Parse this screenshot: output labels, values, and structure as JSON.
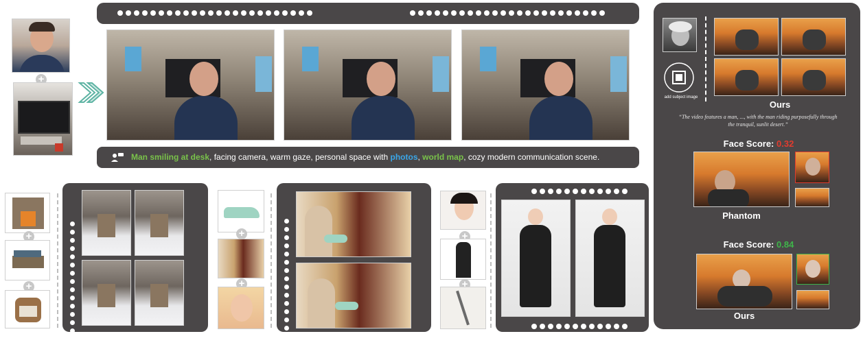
{
  "caption": {
    "highlight_green_1": "Man smiling at desk",
    "text_1": ", facing camera, warm gaze, personal space with ",
    "highlight_blue": "photos",
    "text_2": ", ",
    "highlight_green_2": "world map",
    "text_3": ", cozy modern communication scene."
  },
  "right_panel": {
    "add_subject_label": "add subject image",
    "ours_label_top": "Ours",
    "prompt_text": "“The video features a man, ..., with the man riding purposefully through the tranquil, sunlit desert.”",
    "phantom": {
      "score_label": "Face Score: ",
      "score_value": "0.32",
      "score_color": "#e23b2e",
      "name": "Phantom"
    },
    "ours": {
      "score_label": "Face Score: ",
      "score_value": "0.84",
      "score_color": "#3fb54a",
      "name": "Ours"
    }
  },
  "icons": {
    "plus": "+",
    "arrow": "double-chevron-right-icon",
    "add_subject": "add-subject-icon",
    "user_chat": "user-chat-icon"
  },
  "colors": {
    "panel_bg": "#4a4748",
    "green": "#79c24a",
    "blue": "#3aa6e8",
    "red": "#e23b2e"
  }
}
